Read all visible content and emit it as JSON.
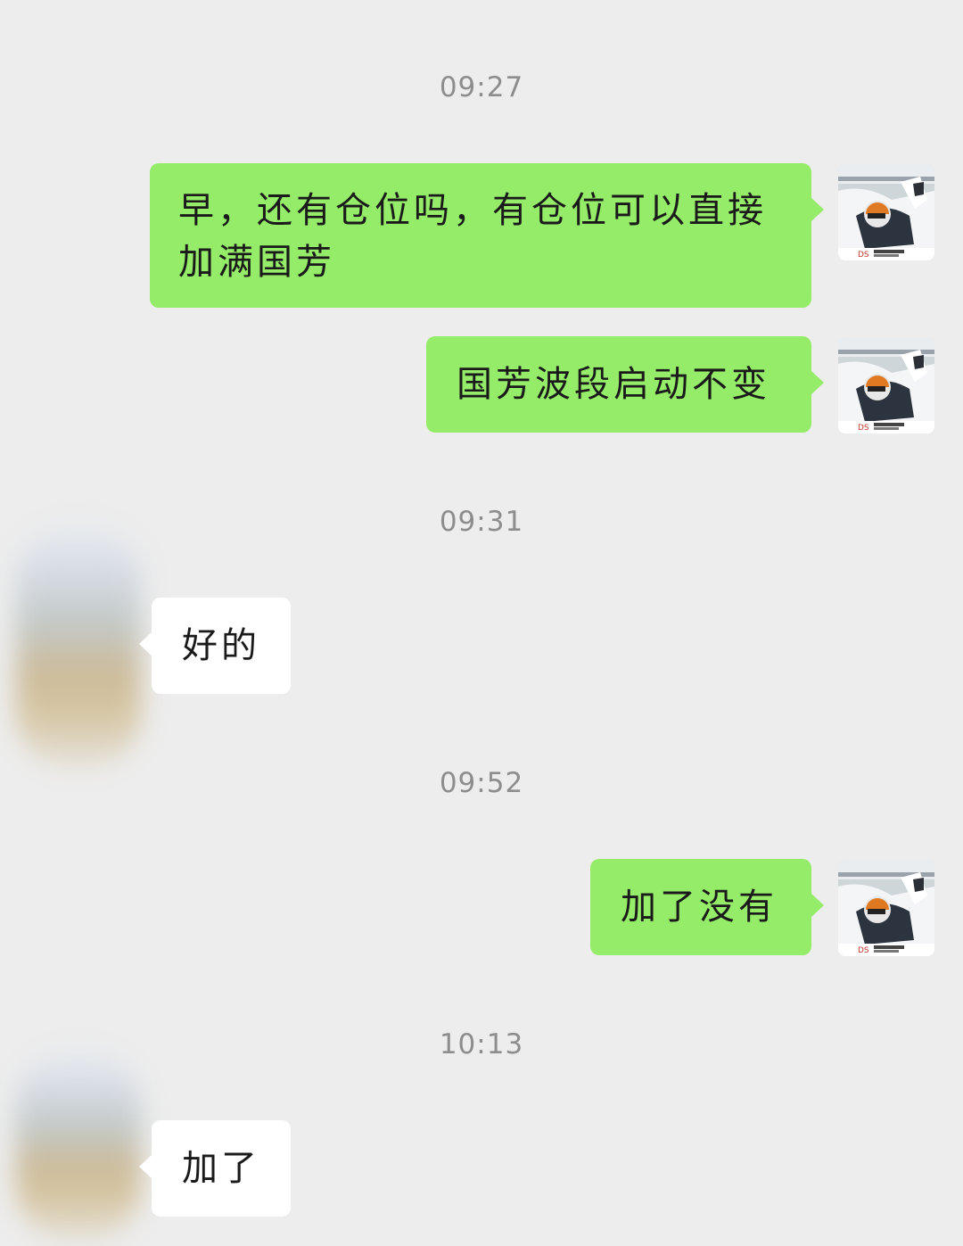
{
  "chat": {
    "messages": [
      {
        "type": "timestamp",
        "text": "09:27"
      },
      {
        "type": "message",
        "sender": "me",
        "text": "早，还有仓位吗，有仓位可以直接加满国芳"
      },
      {
        "type": "message",
        "sender": "me",
        "text": "国芳波段启动不变"
      },
      {
        "type": "timestamp",
        "text": "09:31"
      },
      {
        "type": "message",
        "sender": "them",
        "text": "好的"
      },
      {
        "type": "timestamp",
        "text": "09:52"
      },
      {
        "type": "message",
        "sender": "me",
        "text": "加了没有"
      },
      {
        "type": "timestamp",
        "text": "10:13"
      },
      {
        "type": "message",
        "sender": "them",
        "text": "加了"
      }
    ]
  },
  "colors": {
    "background": "#ededed",
    "my_bubble": "#95ec69",
    "their_bubble": "#ffffff",
    "timestamp_text": "#8d8d8d"
  },
  "icons": {
    "my_avatar": "racing-driver-avatar-icon",
    "their_avatar": "blurred-contact-avatar"
  }
}
